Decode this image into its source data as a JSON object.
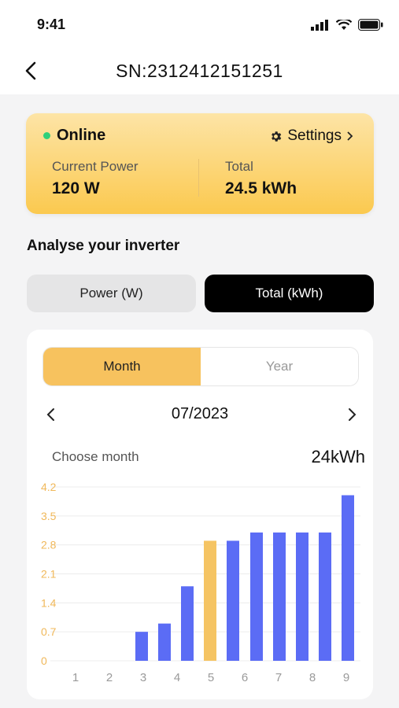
{
  "status": {
    "time": "9:41"
  },
  "nav": {
    "title": "SN:2312412151251"
  },
  "summary": {
    "state": "Online",
    "settings_label": "Settings",
    "current_power_label": "Current Power",
    "current_power_value": "120 W",
    "total_label": "Total",
    "total_value": "24.5 kWh"
  },
  "analyse": {
    "title": "Analyse your inverter",
    "tabs": [
      "Power (W)",
      "Total (kWh)"
    ],
    "active_tab": "Total (kWh)"
  },
  "panel": {
    "periods": [
      "Month",
      "Year"
    ],
    "active_period": "Month",
    "date": "07/2023",
    "choose_label": "Choose month",
    "total": "24kWh"
  },
  "colors": {
    "bar": "#5b6cf5",
    "bar_selected": "#f5c463",
    "axis_text": "#f0b85a",
    "x_text": "#9a9a9a"
  },
  "chart_data": {
    "type": "bar",
    "categories": [
      "1",
      "2",
      "3",
      "4",
      "5",
      "6",
      "7",
      "8",
      "9"
    ],
    "values": [
      0,
      0,
      0.7,
      0.9,
      1.8,
      2.9,
      2.9,
      3.1,
      3.1,
      3.1,
      3.1,
      4.0
    ],
    "series": [
      {
        "values": [
          0,
          0,
          0.7,
          0.9,
          1.8,
          2.9,
          2.9,
          3.1,
          3.1,
          3.1,
          3.1,
          4.0
        ]
      }
    ],
    "selected_index": 4,
    "y_ticks": [
      "0",
      "0.7",
      "1.4",
      "2.1",
      "2.8",
      "3.5",
      "4.2"
    ],
    "ylim": [
      0,
      4.2
    ],
    "grid": true
  }
}
